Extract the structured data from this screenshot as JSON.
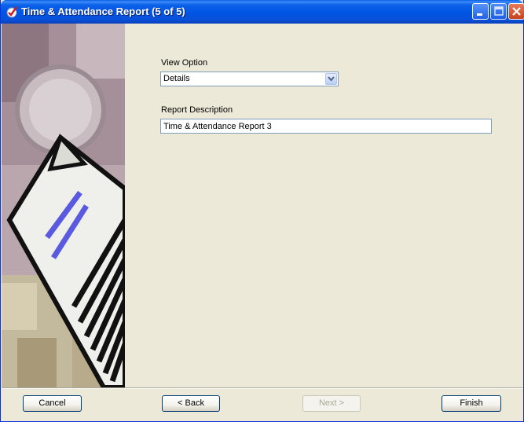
{
  "window": {
    "title": "Time & Attendance Report (5 of 5)"
  },
  "form": {
    "view_option_label": "View Option",
    "view_option_value": "Details",
    "report_description_label": "Report Description",
    "report_description_value": "Time & Attendance Report 3"
  },
  "buttons": {
    "cancel": "Cancel",
    "back": "< Back",
    "next": "Next >",
    "finish": "Finish"
  },
  "icons": {
    "title": "checkmark-icon",
    "minimize": "minimize-icon",
    "maximize": "maximize-icon",
    "close": "close-icon",
    "dropdown": "chevron-down-icon"
  },
  "colors": {
    "titlebar": "#0054e3",
    "dialog_background": "#ece9d8",
    "close_button": "#c7401c",
    "field_border": "#7f9db9",
    "illustration_lines": "#5a5ae0"
  }
}
